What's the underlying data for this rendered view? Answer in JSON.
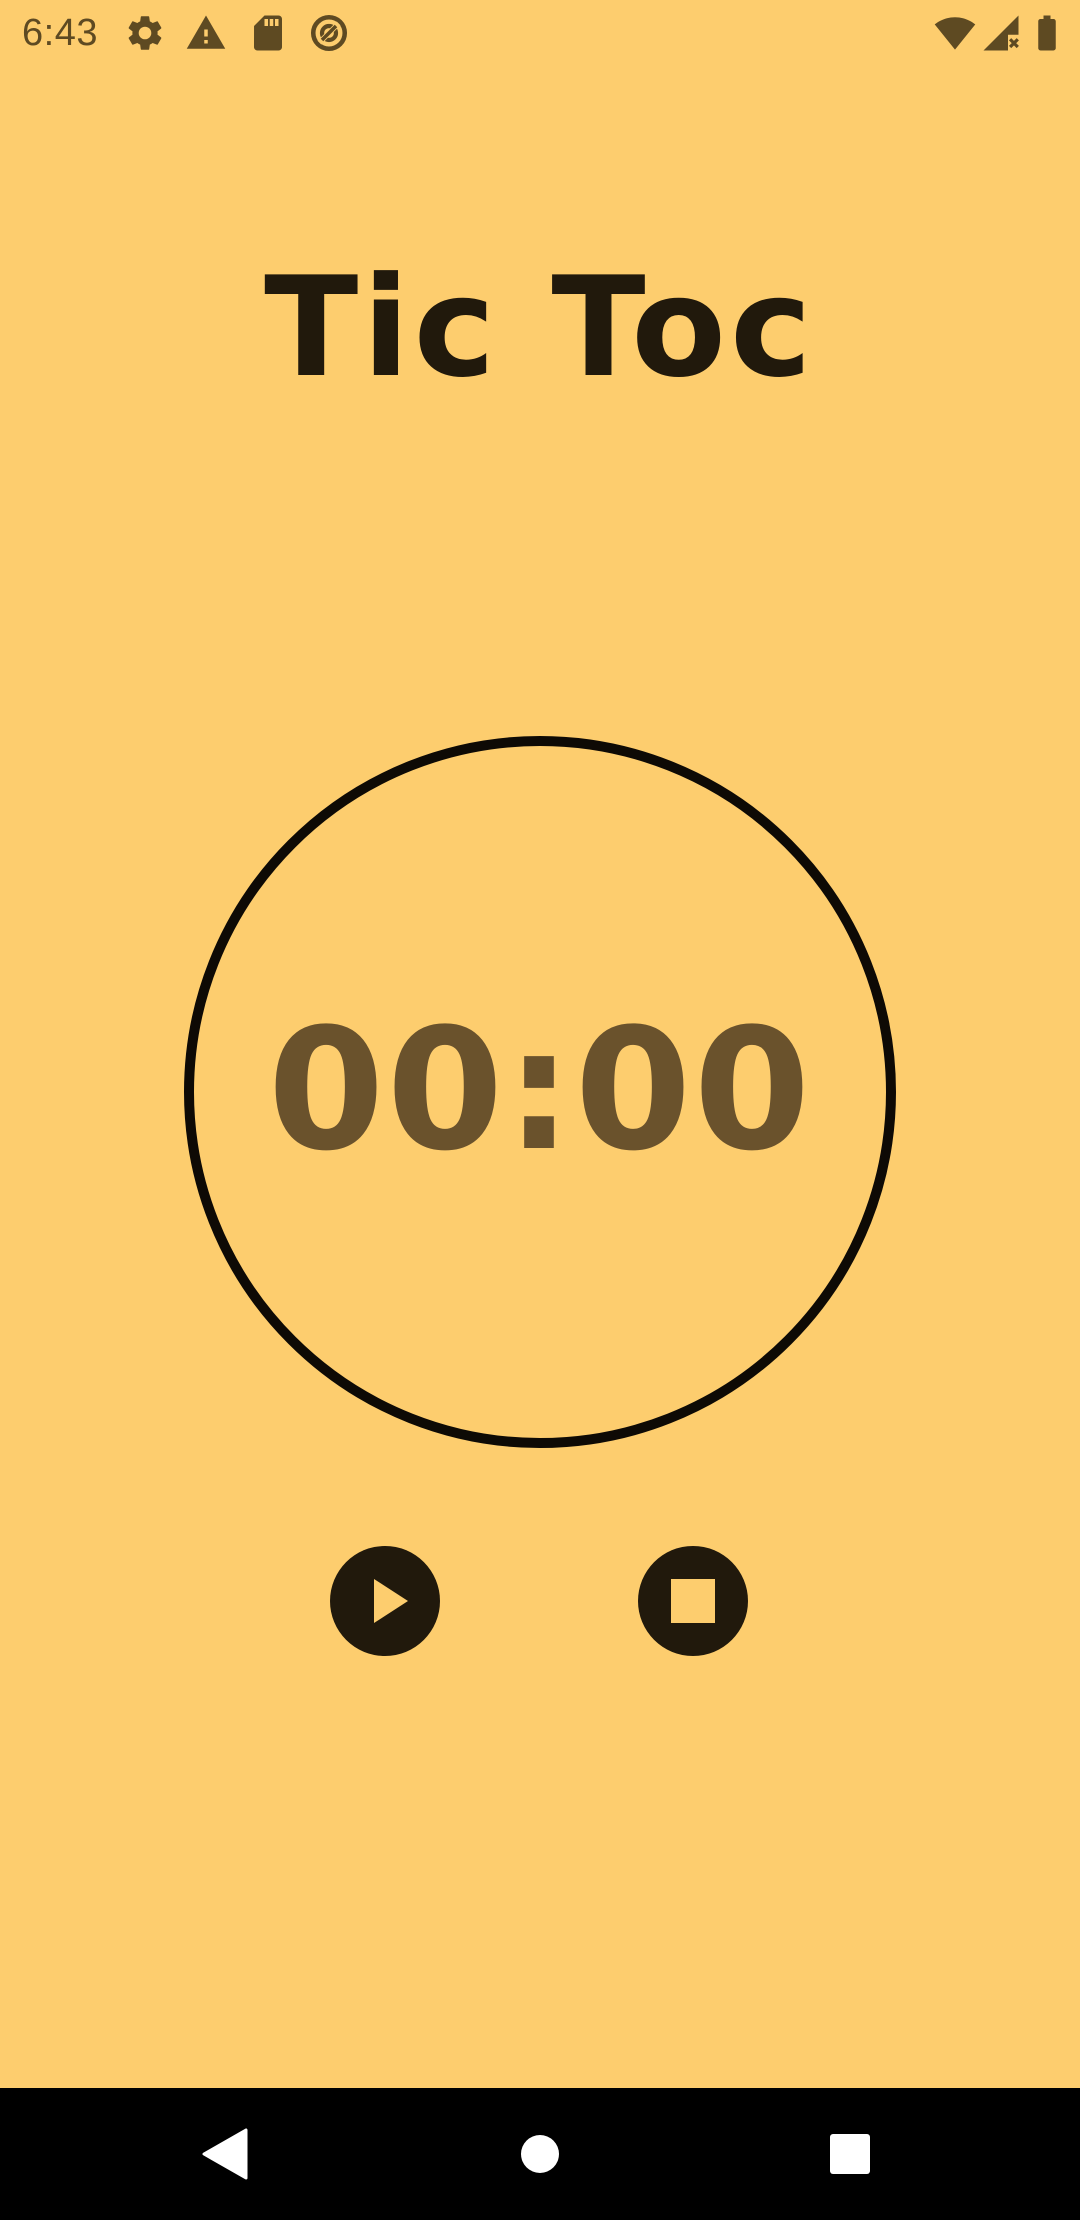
{
  "status_bar": {
    "time": "6:43",
    "left_icons": [
      "gear-icon",
      "warning-icon",
      "sd-card-icon",
      "data-saver-icon"
    ],
    "right_icons": [
      "wifi-icon",
      "cell-signal-icon",
      "battery-icon"
    ]
  },
  "app": {
    "title": "Tic Toc",
    "timer_display": "00:00"
  },
  "controls": {
    "play_icon": "play-icon",
    "stop_icon": "stop-icon"
  },
  "nav_bar": {
    "icons": [
      "back-icon",
      "home-icon",
      "recents-icon"
    ]
  },
  "colors": {
    "background": "#FDCD6E",
    "title": "#21190C",
    "timer_text": "#6A522C",
    "ring": "#0E0A05",
    "button": "#21190C",
    "status_icons": "#5E4A22",
    "nav_bar": "#000000"
  }
}
